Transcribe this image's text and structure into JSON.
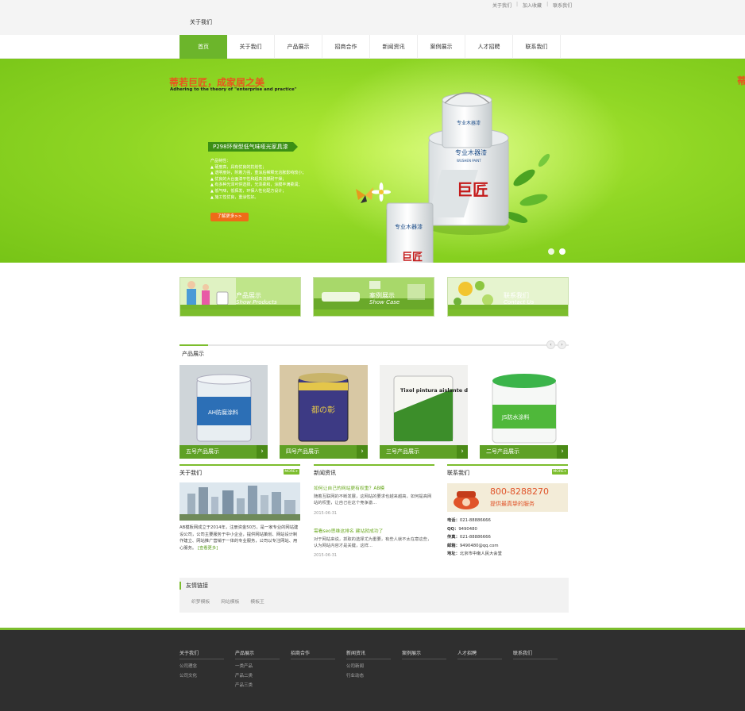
{
  "header": {
    "top_links": [
      "关于我们",
      "加入收藏",
      "联系我们"
    ],
    "logo_text": "关于我们"
  },
  "nav": {
    "items": [
      "首页",
      "关于我们",
      "产品展示",
      "招商合作",
      "新闻资讯",
      "案例展示",
      "人才招聘",
      "联系我们"
    ],
    "active_index": 0
  },
  "banner": {
    "slogan": "蒂若巨匠，成家居之美",
    "slogan_en": "Adhering to the theory of \"enterprise and practice\"",
    "product_tag": "P298环保型低气味哑光家具漆",
    "features_title": "产品特性：",
    "features": [
      "▲ 硬度高，具有优良的抗划性；",
      "▲ 透明度好，附着力强，重涂后稀释无溶胀影响较小；",
      "▲ 优良的大台面漆平性和超高流媒耐干燥；",
      "▲ 有多种光泽可供选择，光泽柔和，涂膜丰满柔润；",
      "▲ 低气味，低挥发，环保人性化配方设计；",
      "▲ 施工性优良，重涂性好。"
    ],
    "more_button": "了解更多>>",
    "slide_count": 2,
    "active_slide": 1,
    "can_brand": "专业木器漆",
    "can_brand_en": "WUSHEN PAINT",
    "can_logo": "巨匠"
  },
  "feature_boxes": [
    {
      "title": "产品展示",
      "subtitle": "Show Products"
    },
    {
      "title": "案例展示",
      "subtitle": "Show Case"
    },
    {
      "title": "联系我们",
      "subtitle": "Contact Us"
    }
  ],
  "products": {
    "section_title": "产品展示",
    "prev": "‹",
    "next": "›",
    "items": [
      {
        "label": "五号产品展示",
        "arrow": "›",
        "can_text": "AH防腐涂料"
      },
      {
        "label": "四号产品展示",
        "arrow": "›",
        "can_text": "都の彰"
      },
      {
        "label": "三号产品展示",
        "arrow": "›",
        "can_text": "Tixol pintura aislante de manches"
      },
      {
        "label": "二号产品展示",
        "arrow": "›",
        "can_text": "JS防水涂料"
      }
    ]
  },
  "about": {
    "title": "关于我们",
    "more": "MORE+",
    "text": "AB模板网成立于2014年，注册资金50万，是一家专业的网站建设公司，公司主要服务于中小企业，提供网站策划、网站设计制作建立、网站推广营销于一体的专业服务，公司以专注网站、用心服务。",
    "link": "[查看更多]"
  },
  "news": {
    "title": "新闻资讯",
    "items": [
      {
        "title": "如何让自己的网站更有权重？AB模",
        "body": "随着互联网的不断发展，这网站的要求也越来越高，如何提高网站的权重，让自己在这个竞争激...",
        "date": "2015-06-31"
      },
      {
        "title": "需看seo思维这排名 建站就成功了",
        "body": "对于网站来说，抓取的选择尤为重要，有些人就不太在意这些，认为网站内容才是关键，这样...",
        "date": "2015-06-31"
      }
    ]
  },
  "contact": {
    "title": "联系我们",
    "more": "MORE+",
    "banner_phone": "800-8288270",
    "banner_slogan": "提供最真挚的服务",
    "lines": [
      {
        "k": "电话：",
        "v": "021-88886666"
      },
      {
        "k": "QQ：",
        "v": "9490480"
      },
      {
        "k": "传真：",
        "v": "021-88886666"
      },
      {
        "k": "邮箱：",
        "v": "9490480@qq.com"
      },
      {
        "k": "地址：",
        "v": "北京市中南人民大会堂"
      }
    ]
  },
  "friends": {
    "title": "友情链接",
    "links": [
      "织梦模板",
      "网站模板",
      "模板王"
    ]
  },
  "footer": {
    "columns": [
      {
        "head": "关于我们",
        "items": [
          "公司理念",
          "公司文化"
        ]
      },
      {
        "head": "产品展示",
        "items": [
          "一类产品",
          "产品二类",
          "产品三类"
        ]
      },
      {
        "head": "招商合作",
        "items": []
      },
      {
        "head": "新闻资讯",
        "items": [
          "公司新闻",
          "行业动态"
        ]
      },
      {
        "head": "案例展示",
        "items": []
      },
      {
        "head": "人才招聘",
        "items": []
      },
      {
        "head": "联系我们",
        "items": []
      }
    ]
  },
  "colors": {
    "brand_green": "#6cb52b",
    "banner_green": "#8fd624",
    "accent_orange": "#ef6b18",
    "footer_bg": "#2f2f2f"
  }
}
